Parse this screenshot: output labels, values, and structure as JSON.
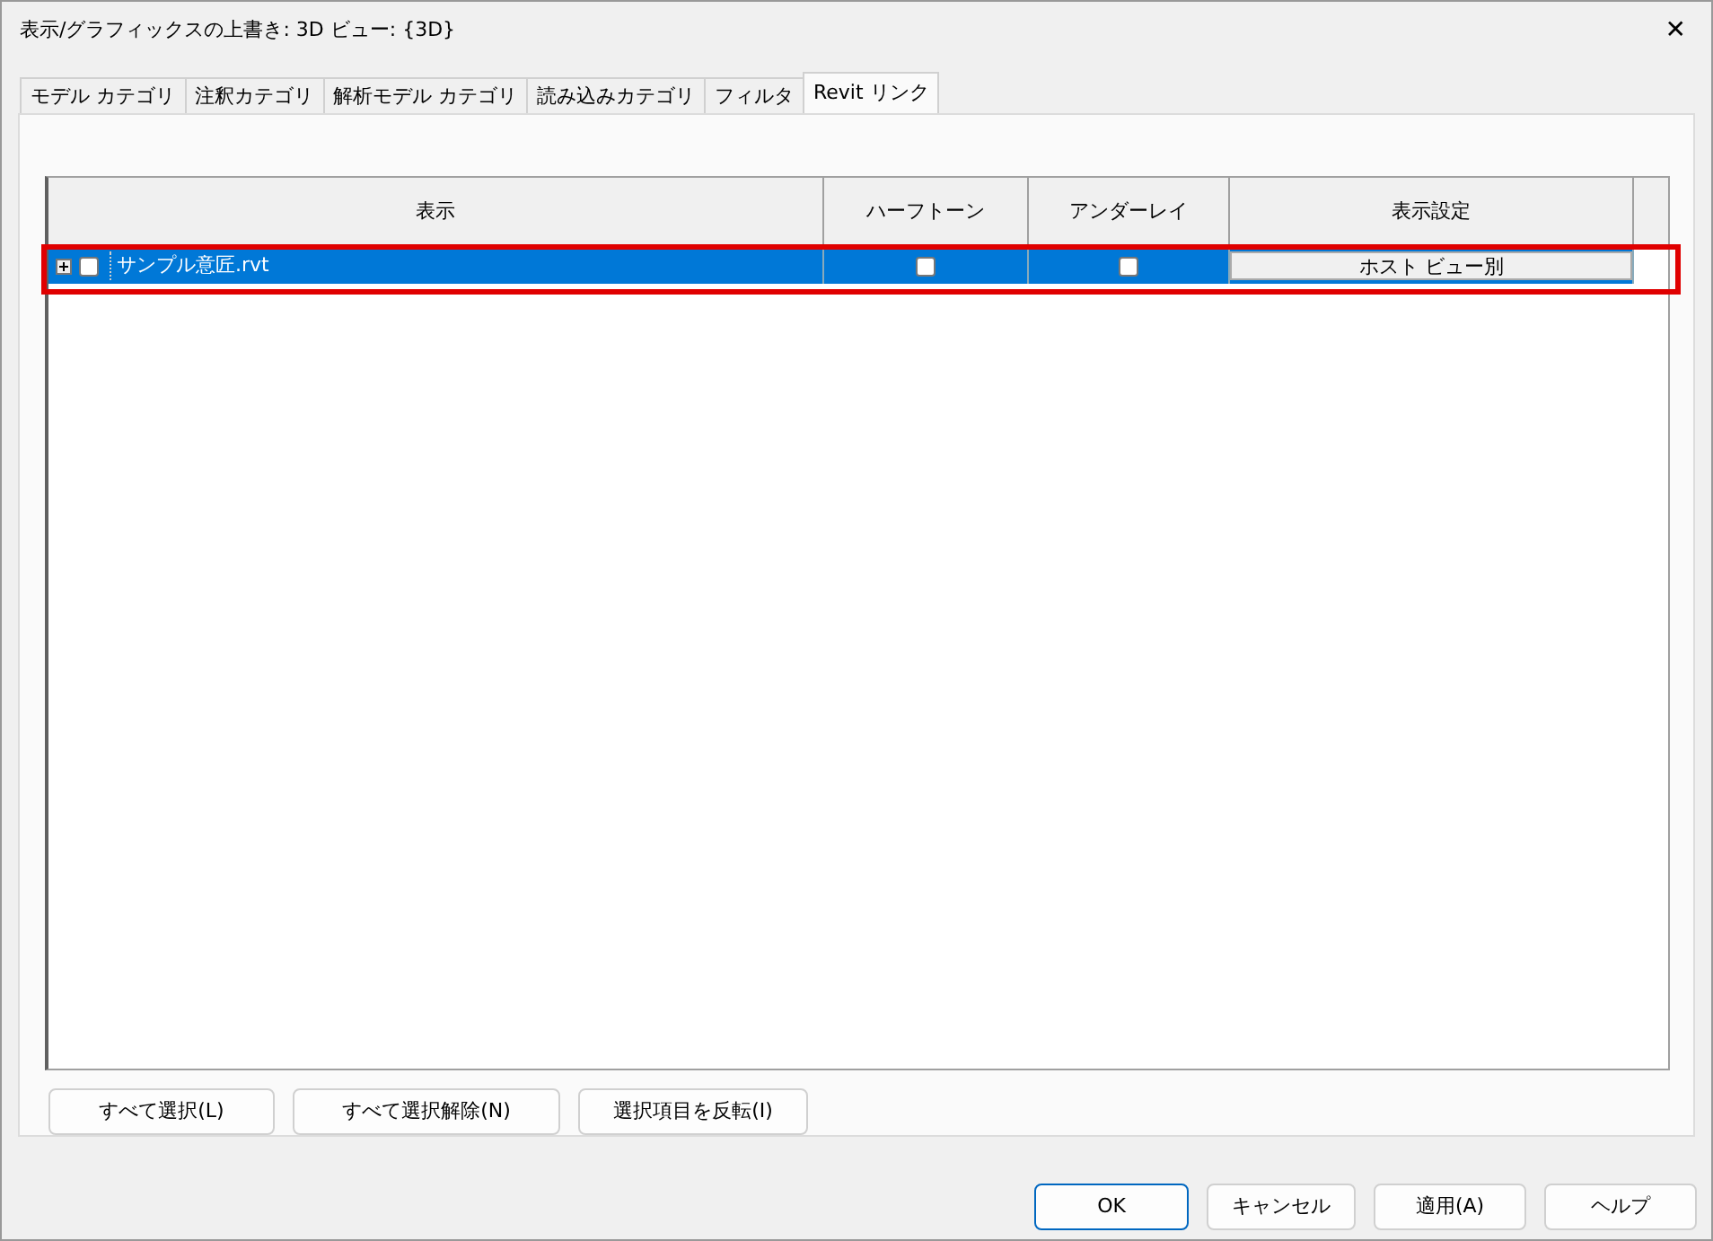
{
  "window": {
    "title": "表示/グラフィックスの上書き: 3D ビュー: {3D}",
    "close": "✕"
  },
  "tabs": [
    {
      "label": "モデル カテゴリ",
      "selected": false
    },
    {
      "label": "注釈カテゴリ",
      "selected": false
    },
    {
      "label": "解析モデル カテゴリ",
      "selected": false
    },
    {
      "label": "読み込みカテゴリ",
      "selected": false
    },
    {
      "label": "フィルタ",
      "selected": false
    },
    {
      "label": "Revit リンク",
      "selected": true
    }
  ],
  "table": {
    "columns": [
      "表示",
      "ハーフトーン",
      "アンダーレイ",
      "表示設定"
    ],
    "rows": [
      {
        "name": "サンプル意匠.rvt",
        "expanded": false,
        "visible": false,
        "halftone": false,
        "underlay": false,
        "display_setting": "ホスト ビュー別",
        "selected": true,
        "highlighted": true
      }
    ]
  },
  "selection_buttons": [
    "すべて選択(L)",
    "すべて選択解除(N)",
    "選択項目を反転(I)"
  ],
  "dialog_buttons": [
    {
      "label": "OK",
      "default": true
    },
    {
      "label": "キャンセル",
      "default": false
    },
    {
      "label": "適用(A)",
      "default": false
    },
    {
      "label": "ヘルプ",
      "default": false
    }
  ]
}
